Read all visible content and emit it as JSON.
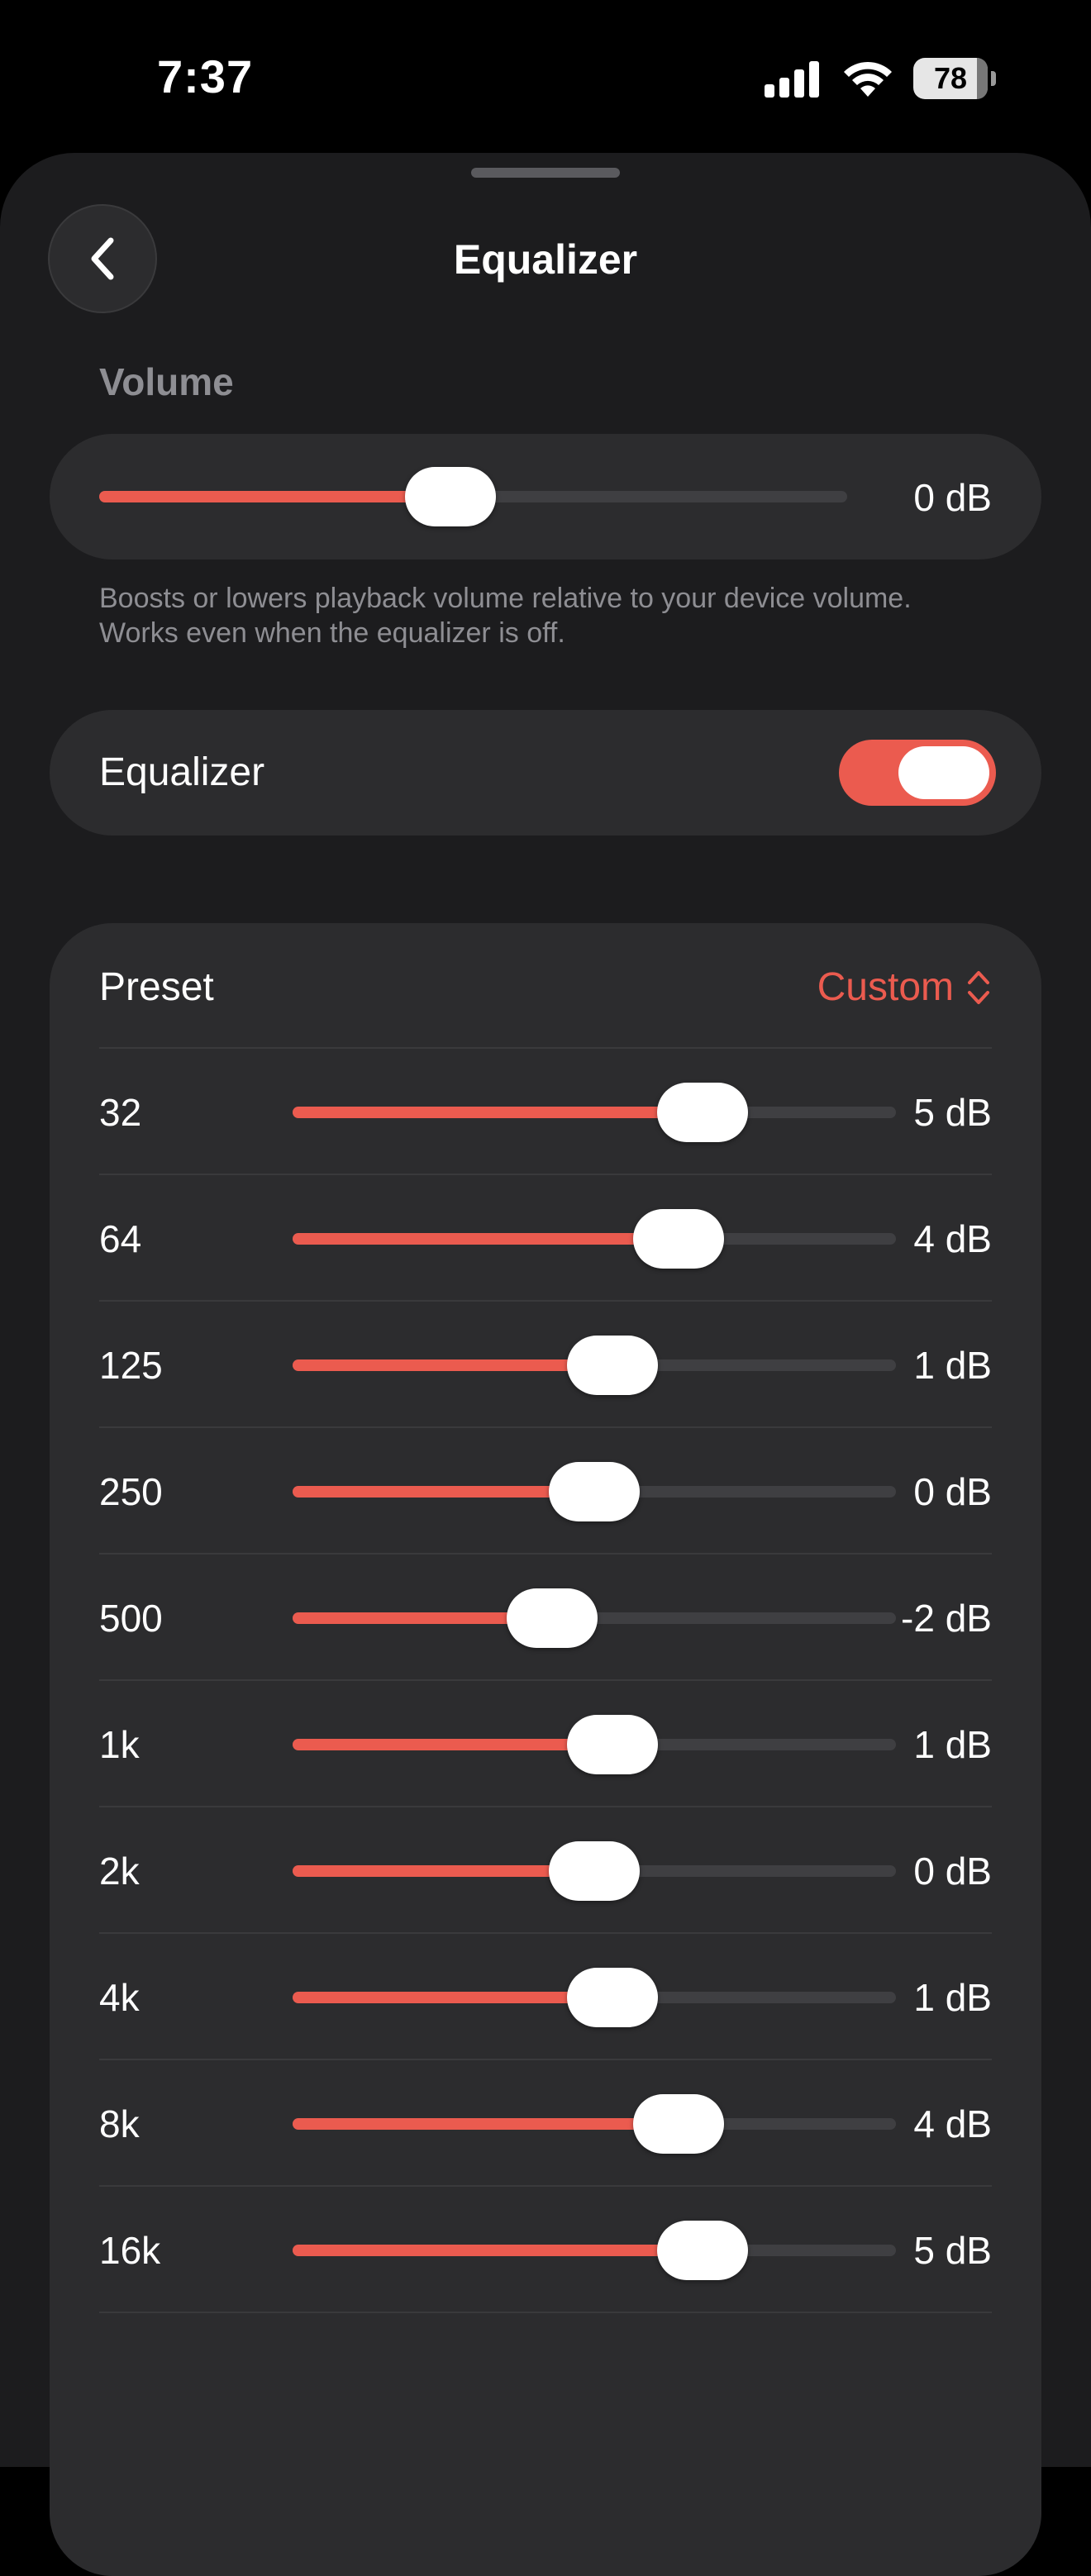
{
  "status_bar": {
    "time": "7:37",
    "battery": "78",
    "battery_level_percent": 78
  },
  "header": {
    "title": "Equalizer",
    "back_icon": "chevron-left-icon"
  },
  "volume": {
    "section_label": "Volume",
    "value_label": "0 dB",
    "level_fraction": 0.47,
    "helper_text": "Boosts or lowers playback volume relative to your device volume. Works even when the equalizer is off."
  },
  "equalizer_toggle": {
    "label": "Equalizer",
    "enabled": true
  },
  "preset": {
    "label": "Preset",
    "value": "Custom",
    "chevron_icon": "chevron-up-down-icon"
  },
  "bands": [
    {
      "freq": "32",
      "gain": "5 dB",
      "level_fraction": 0.68
    },
    {
      "freq": "64",
      "gain": "4 dB",
      "level_fraction": 0.64
    },
    {
      "freq": "125",
      "gain": "1 dB",
      "level_fraction": 0.53
    },
    {
      "freq": "250",
      "gain": "0 dB",
      "level_fraction": 0.5
    },
    {
      "freq": "500",
      "gain": "-2 dB",
      "level_fraction": 0.43
    },
    {
      "freq": "1k",
      "gain": "1 dB",
      "level_fraction": 0.53
    },
    {
      "freq": "2k",
      "gain": "0 dB",
      "level_fraction": 0.5
    },
    {
      "freq": "4k",
      "gain": "1 dB",
      "level_fraction": 0.53
    },
    {
      "freq": "8k",
      "gain": "4 dB",
      "level_fraction": 0.64
    },
    {
      "freq": "16k",
      "gain": "5 dB",
      "level_fraction": 0.68
    }
  ],
  "colors": {
    "accent": "#eb5b4f",
    "background": "#000000",
    "sheet": "#1c1c1e",
    "card": "#2c2c2e",
    "secondary_text": "#8e8e93"
  }
}
